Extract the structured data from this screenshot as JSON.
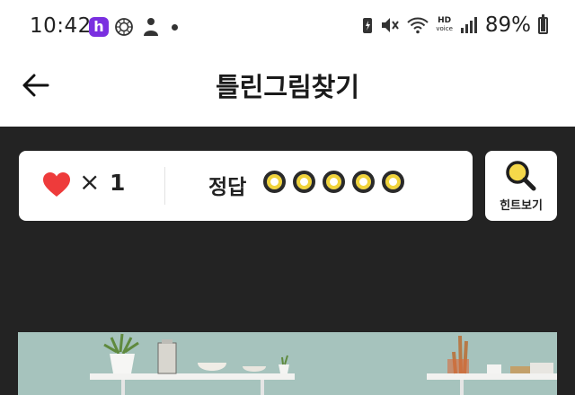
{
  "status_bar": {
    "time": "10:42",
    "app_badge": "h",
    "hd_line1": "HD",
    "hd_line2": "voice",
    "battery_percent": "89%",
    "battery_level": 0.89
  },
  "header": {
    "title": "틀린그림찾기"
  },
  "game": {
    "times_symbol": "×",
    "lives": "1",
    "answer_label": "정답",
    "answer_slots_total": 5,
    "answer_slots_found": 0
  },
  "hint": {
    "label": "힌트보기"
  },
  "colors": {
    "heart": "#ee3b3b",
    "slot_ring": "#f0d33a",
    "background": "#232323",
    "app_badge": "#7a2fe0"
  }
}
